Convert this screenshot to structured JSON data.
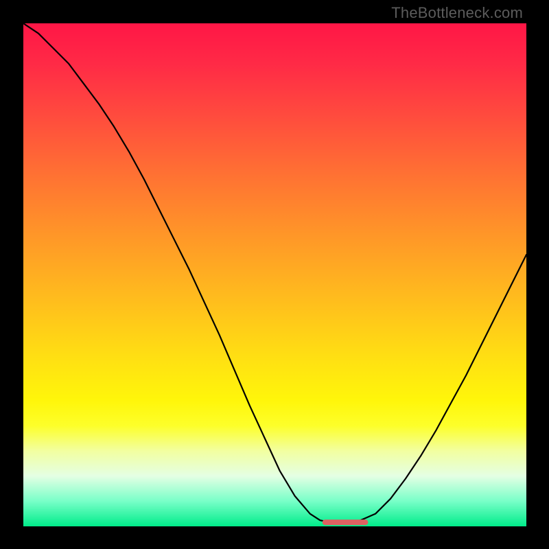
{
  "watermark": "TheBottleneck.com",
  "chart_data": {
    "type": "line",
    "title": "",
    "xlabel": "",
    "ylabel": "",
    "xlim": [
      0,
      100
    ],
    "ylim": [
      0,
      100
    ],
    "grid": false,
    "series": [
      {
        "name": "bottleneck-curve",
        "x": [
          0,
          3,
          6,
          9,
          12,
          15,
          18,
          21,
          24,
          27,
          30,
          33,
          36,
          39,
          42,
          45,
          48,
          51,
          54,
          57,
          59,
          61,
          63,
          65,
          67,
          70,
          73,
          76,
          79,
          82,
          85,
          88,
          91,
          94,
          97,
          100
        ],
        "y": [
          100,
          98,
          95,
          92,
          88,
          84,
          79.5,
          74.5,
          69,
          63,
          57,
          51,
          44.5,
          38,
          31,
          24,
          17.5,
          11,
          6,
          2.5,
          1.2,
          0.8,
          0.8,
          0.8,
          1.2,
          2.5,
          5.5,
          9.5,
          14,
          19,
          24.5,
          30,
          36,
          42,
          48,
          54
        ]
      }
    ],
    "flat_segment": {
      "x_start": 60,
      "x_end": 68,
      "y": 0.8,
      "stroke": "#dc6161",
      "stroke_width_px": 8
    },
    "background_gradient": {
      "stops": [
        {
          "pct": 0,
          "color": "#ff1646"
        },
        {
          "pct": 18,
          "color": "#ff4a3e"
        },
        {
          "pct": 42,
          "color": "#ff9628"
        },
        {
          "pct": 67,
          "color": "#ffe112"
        },
        {
          "pct": 85,
          "color": "#f2ffa0"
        },
        {
          "pct": 100,
          "color": "#00ec8a"
        }
      ]
    }
  }
}
